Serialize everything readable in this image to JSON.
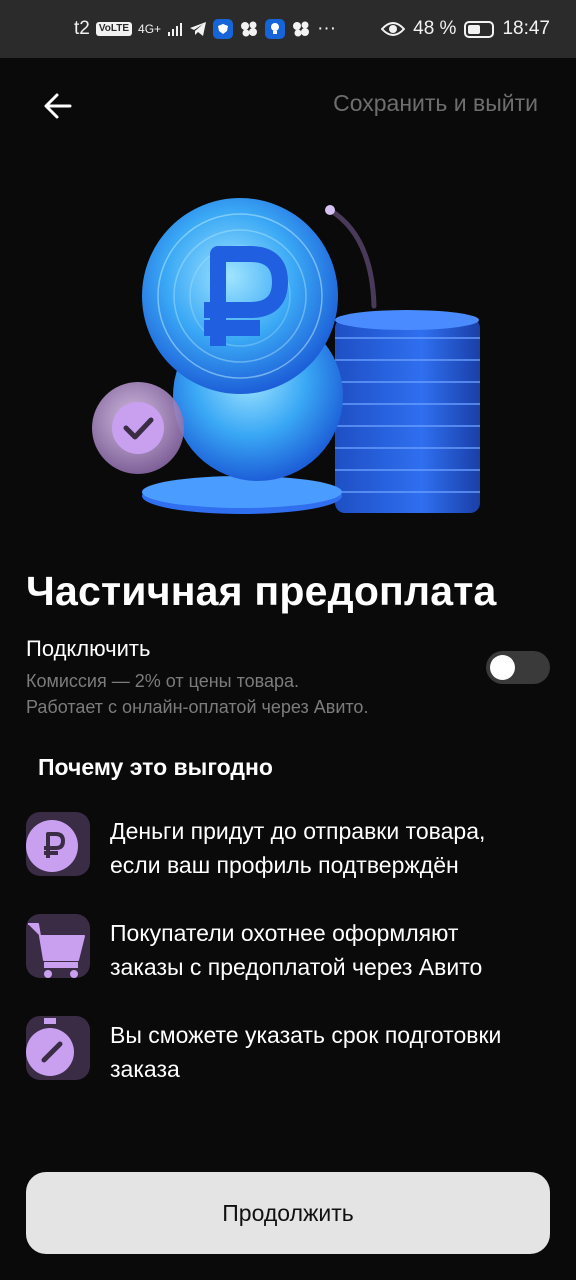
{
  "status_bar": {
    "carrier": "t2",
    "volte": "VoLTE",
    "network": "4G+",
    "more": "···",
    "battery": "48 %",
    "time": "18:47"
  },
  "nav": {
    "back_icon": "arrow-left-icon",
    "save_exit": "Сохранить и выйти"
  },
  "hero": {
    "icons": [
      "ruble-coin-icon",
      "coin-stack-icon",
      "check-badge-icon"
    ]
  },
  "title": "Частичная предоплата",
  "toggle": {
    "label": "Подключить",
    "description_line1": "Комиссия — 2% от цены товара.",
    "description_line2": "Работает с онлайн-оплатой через Авито.",
    "enabled": false
  },
  "why": {
    "title": "Почему это выгодно",
    "items": [
      {
        "icon": "ruble-icon",
        "line1": "Деньги придут до отправки товара,",
        "line2": "если ваш профиль подтверждён"
      },
      {
        "icon": "cart-icon",
        "line1": "Покупатели охотнее оформляют",
        "line2": "заказы с предоплатой через Авито"
      },
      {
        "icon": "timer-icon",
        "line1": "Вы сможете указать срок подготовки",
        "line2": "заказа"
      }
    ]
  },
  "continue_label": "Продолжить",
  "colors": {
    "background": "#0a0a0a",
    "accent_purple": "#c9a0f0",
    "coin_blue": "#3a8cff",
    "button_bg": "#e4e4e4"
  }
}
